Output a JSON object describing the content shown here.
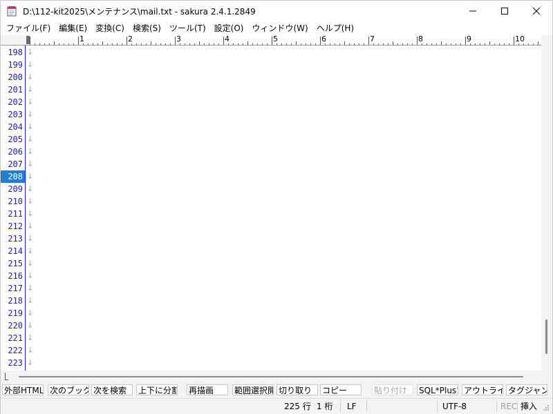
{
  "window": {
    "title": "D:\\112-kit2025\\メンテナンス\\mail.txt - sakura 2.4.1.2849"
  },
  "menu": [
    {
      "label": "ファイル(F)"
    },
    {
      "label": "編集(E)"
    },
    {
      "label": "変換(C)"
    },
    {
      "label": "検索(S)"
    },
    {
      "label": "ツール(T)"
    },
    {
      "label": "設定(O)"
    },
    {
      "label": "ウィンドウ(W)"
    },
    {
      "label": "ヘルプ(H)"
    }
  ],
  "ruler": {
    "marks": [
      "1",
      "2",
      "3",
      "4",
      "5",
      "6",
      "7",
      "8",
      "9",
      "10"
    ]
  },
  "editor": {
    "eol_mark": "↓",
    "current_line": "208",
    "lines": [
      "198",
      "199",
      "200",
      "201",
      "202",
      "203",
      "204",
      "205",
      "206",
      "207",
      "208",
      "209",
      "210",
      "211",
      "212",
      "213",
      "214",
      "215",
      "216",
      "217",
      "218",
      "219",
      "220",
      "221",
      "222",
      "223"
    ]
  },
  "function_keys": [
    {
      "label": "外部HTMLへ",
      "enabled": true
    },
    {
      "label": "次のブックマーク",
      "enabled": true
    },
    {
      "label": "次を検索",
      "enabled": true
    },
    {
      "label": "上下に分割",
      "enabled": true
    },
    {
      "label": "再描画",
      "enabled": true
    },
    {
      "label": "範囲選択開始",
      "enabled": true
    },
    {
      "label": "切り取り",
      "enabled": true
    },
    {
      "label": "コピー",
      "enabled": true
    },
    {
      "label": "貼り付け",
      "enabled": false
    },
    {
      "label": "SQL*Plusで実行",
      "enabled": true
    },
    {
      "label": "アウトライン",
      "enabled": true
    },
    {
      "label": "タグジャンプ",
      "enabled": true
    }
  ],
  "status": {
    "row": "225 行",
    "col": "1 桁",
    "eol": "LF",
    "encoding": "UTF-8",
    "rec": "REC",
    "mode": "挿入"
  },
  "colors": {
    "line_number": "#1a1ad6",
    "current_line_bg": "#1c7fd1",
    "eol_mark": "#8aa7e0"
  }
}
